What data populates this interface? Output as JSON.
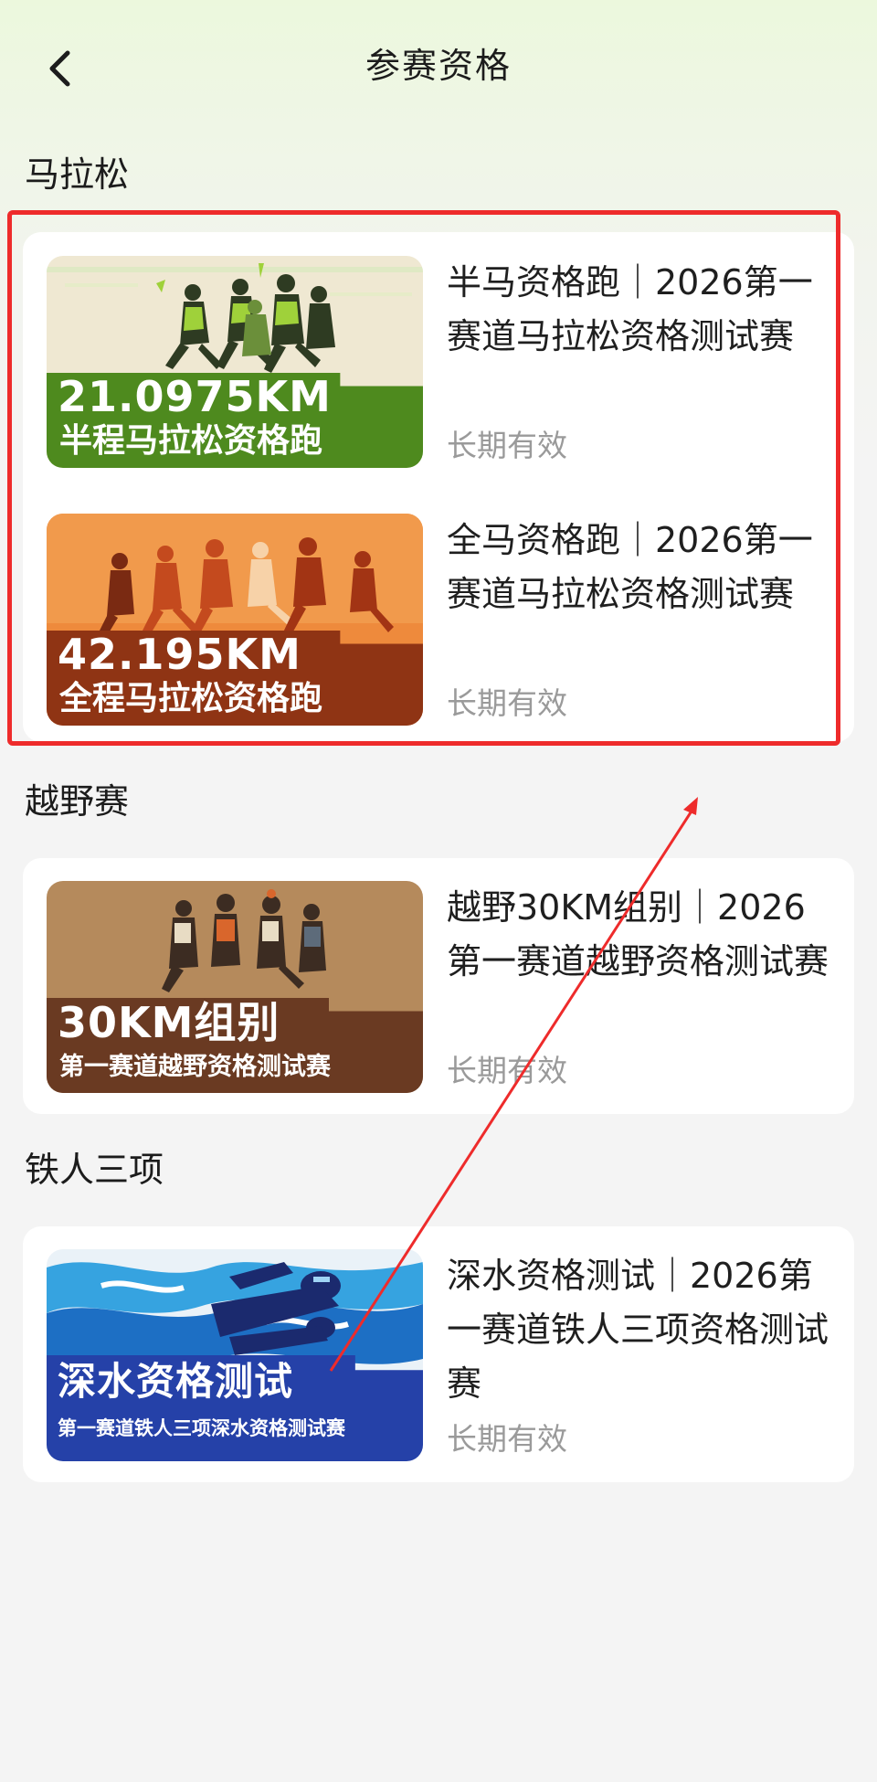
{
  "header": {
    "title": "参赛资格"
  },
  "sections": [
    {
      "title": "马拉松",
      "items": [
        {
          "title": "半马资格跑｜2026第一赛道马拉松资格测试赛",
          "validity": "长期有效",
          "image_line1": "21.0975KM",
          "image_line2": "半程马拉松资格跑",
          "image_theme": "green-runners"
        },
        {
          "title": "全马资格跑｜2026第一赛道马拉松资格测试赛",
          "validity": "长期有效",
          "image_line1": "42.195KM",
          "image_line2": "全程马拉松资格跑",
          "image_theme": "orange-runners"
        }
      ]
    },
    {
      "title": "越野赛",
      "items": [
        {
          "title": "越野30KM组别｜2026第一赛道越野资格测试赛",
          "validity": "长期有效",
          "image_line1": "30KM组别",
          "image_line2": "第一赛道越野资格测试赛",
          "image_theme": "brown-trail-runners"
        }
      ]
    },
    {
      "title": "铁人三项",
      "items": [
        {
          "title": "深水资格测试｜2026第一赛道铁人三项资格测试赛",
          "validity": "长期有效",
          "image_line1": "深水资格测试",
          "image_line2": "第一赛道铁人三项深水资格测试赛",
          "image_theme": "blue-swimmer"
        }
      ]
    }
  ],
  "icons": {
    "back": "chevron-left-icon"
  },
  "colors": {
    "annotation_red": "#ee2b2b",
    "validity_gray": "#9a9a9a",
    "marathon_half_banner": "#4e8a1e",
    "marathon_full_banner": "#8f3414",
    "trail_banner": "#6a3a22",
    "triathlon_banner": "#2541a8"
  }
}
